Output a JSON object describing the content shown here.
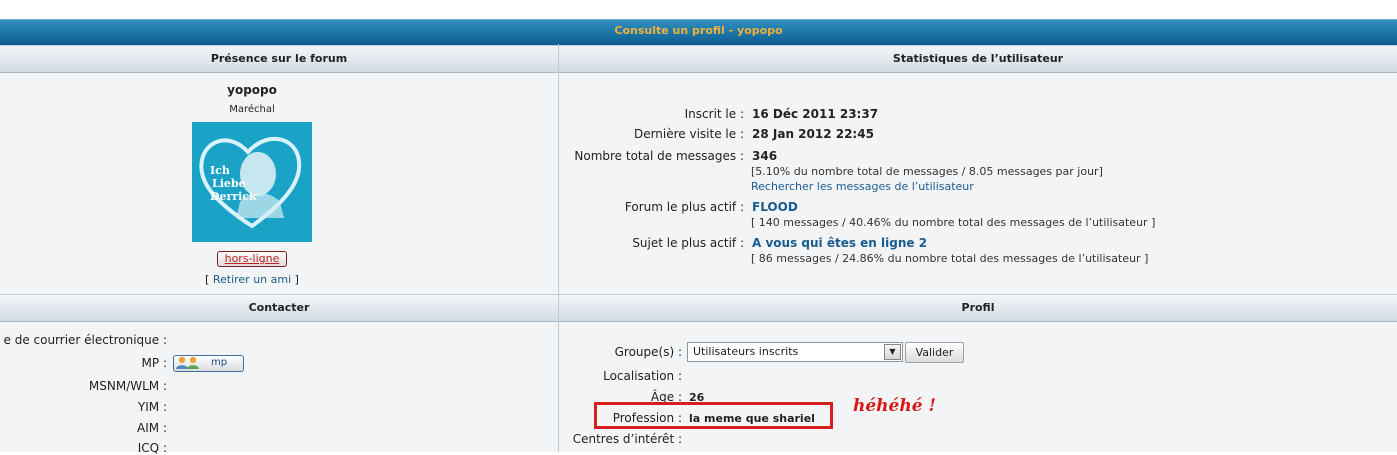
{
  "page": {
    "title": "Consulte un profil - yopopo"
  },
  "left_top": {
    "header": "Présence sur le forum",
    "username": "yopopo",
    "rank": "Maréchal",
    "avatar_text": [
      "Ich",
      "Liebe",
      "Derrick"
    ],
    "status_button": "hors-ligne",
    "remove_friend": "Retirer un ami",
    "bracket_open": "[",
    "bracket_close": "]"
  },
  "right_top": {
    "header": "Statistiques de l’utilisateur",
    "rows": [
      {
        "label": "Inscrit le :",
        "value": "16 Déc 2011 23:37"
      },
      {
        "label": "Dernière visite le :",
        "value": "28 Jan 2012 22:45"
      },
      {
        "label": "Nombre total de messages :",
        "value": "346",
        "detail": "[5.10% du nombre total de messages / 8.05 messages par jour]",
        "link": "Rechercher les messages de l’utilisateur"
      },
      {
        "label": "Forum le plus actif :",
        "value": "FLOOD",
        "detail": "[ 140 messages / 40.46% du nombre total des messages de l’utilisateur ]"
      },
      {
        "label": "Sujet le plus actif :",
        "value": "A vous qui êtes en ligne 2",
        "detail": "[ 86 messages / 24.86% du nombre total des messages de l’utilisateur ]"
      }
    ]
  },
  "left_bottom": {
    "header": "Contacter",
    "rows": [
      {
        "label": "e de courrier électronique :"
      },
      {
        "label": "MP :",
        "button": "mp"
      },
      {
        "label": "MSNM/WLM :"
      },
      {
        "label": "YIM :"
      },
      {
        "label": "AIM :"
      },
      {
        "label": "ICQ :"
      }
    ]
  },
  "right_bottom": {
    "header": "Profil",
    "group_label": "Groupe(s) :",
    "group_selected": "Utilisateurs inscrits",
    "validate_button": "Valider",
    "location_label": "Localisation :",
    "age_label": "Âge :",
    "age_value": "26",
    "profession_label": "Profession :",
    "profession_value": "la meme que shariel",
    "interests_label": "Centres d’intérêt :"
  },
  "annotation": "héhéhé !",
  "colors": {
    "title_text": "#f0b23c",
    "title_bar": "#0b5d8f",
    "link": "#1a5c8f",
    "highlight": "#d62020"
  }
}
